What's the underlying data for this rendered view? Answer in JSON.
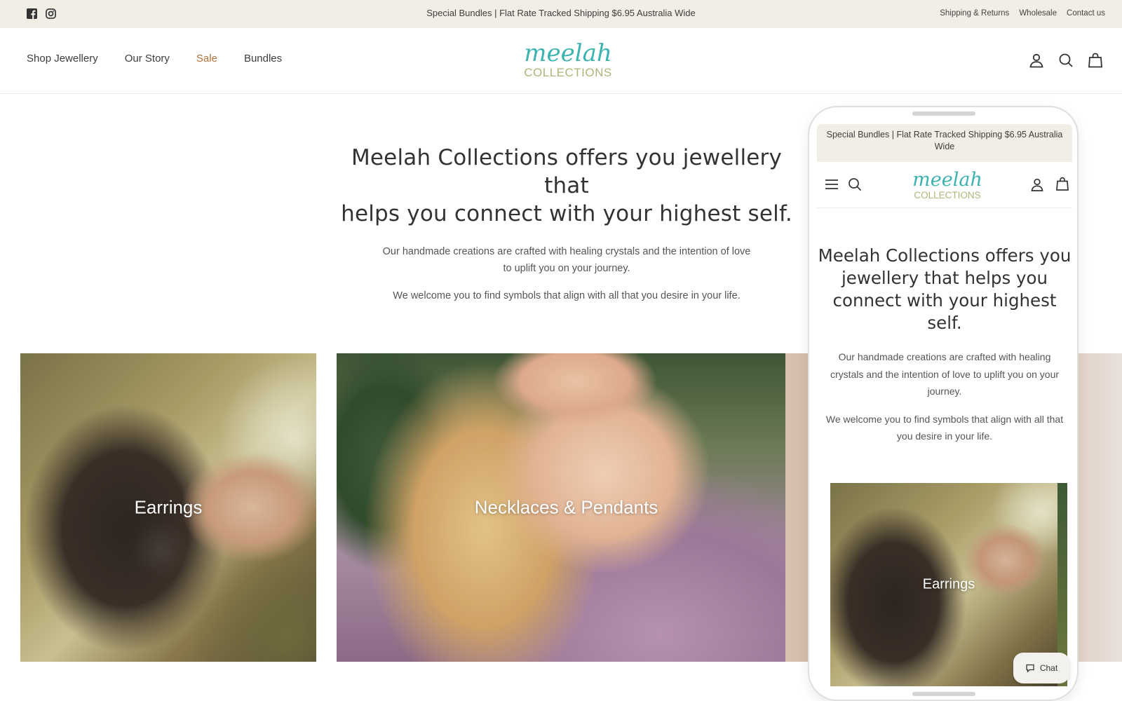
{
  "announcement": {
    "message": "Special Bundles | Flat Rate Tracked Shipping $6.95 Australia Wide",
    "links": [
      "Shipping & Returns",
      "Wholesale",
      "Contact us"
    ],
    "social": [
      "facebook-icon",
      "instagram-icon"
    ]
  },
  "header": {
    "nav": [
      "Shop Jewellery",
      "Our Story",
      "Sale",
      "Bundles"
    ],
    "logo_script": "meelah",
    "logo_sub": "COLLECTIONS",
    "icons": [
      "account-icon",
      "search-icon",
      "cart-icon"
    ]
  },
  "hero": {
    "heading_line1": "Meelah Collections offers you jewellery that",
    "heading_line2": "helps you connect with your highest self.",
    "paragraph1": "Our handmade creations are crafted with healing crystals and the intention of love to uplift you on your journey.",
    "paragraph2": "We welcome you to find symbols that align with all that you desire in your life."
  },
  "collections": [
    {
      "label": "Earrings"
    },
    {
      "label": "Necklaces & Pendants"
    }
  ],
  "phone": {
    "announcement": "Special Bundles | Flat Rate Tracked Shipping $6.95 Australia Wide",
    "heading": "Meelah Collections offers you jewellery that helps you connect with your highest self.",
    "paragraph1": "Our handmade creations are crafted with healing crystals and the intention of love to uplift you on your journey.",
    "paragraph2": "We welcome you to find symbols that align with all that you desire in your life.",
    "tile_label": "Earrings",
    "chat_label": "Chat"
  },
  "colors": {
    "announcement_bg": "#f1eee6",
    "sale_accent": "#b5703a",
    "logo_teal": "#3bb3b0",
    "logo_sub": "#a8b878"
  }
}
